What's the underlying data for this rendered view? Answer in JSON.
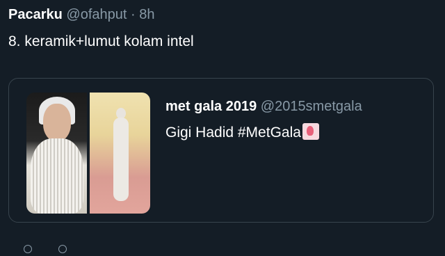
{
  "tweet": {
    "name": "Pacarku",
    "handle": "@ofahput",
    "separator": "·",
    "time": "8h",
    "text": "8. keramik+lumut kolam intel"
  },
  "quote": {
    "name": "met gala 2019",
    "handle": "@2015smetgala",
    "text": "Gigi Hadid #MetGala",
    "emoji_icon": "flamingo-icon"
  },
  "colors": {
    "background": "#141d26",
    "secondary_text": "#8899a6",
    "border": "#38444d"
  }
}
